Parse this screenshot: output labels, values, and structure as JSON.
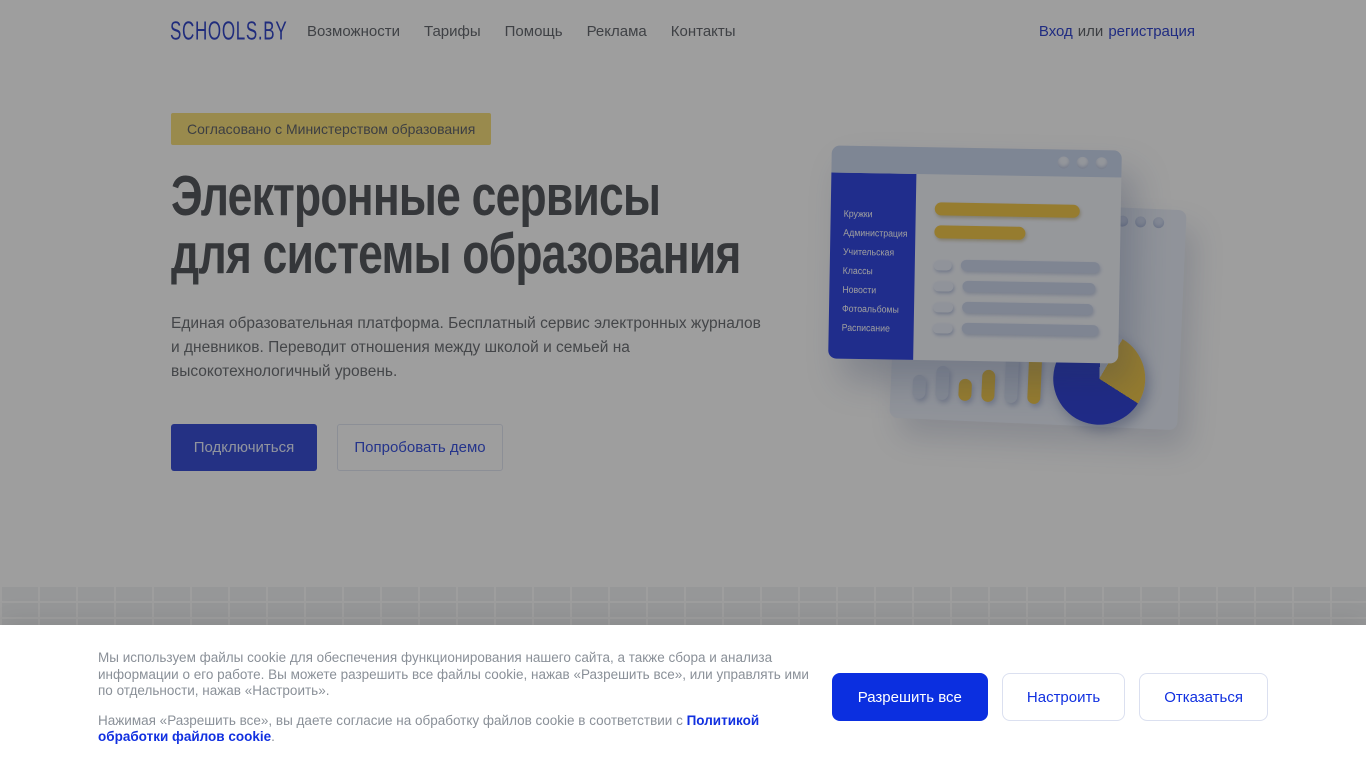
{
  "header": {
    "logo": "SCHOOLS.BY",
    "nav": [
      "Возможности",
      "Тарифы",
      "Помощь",
      "Реклама",
      "Контакты"
    ],
    "auth": {
      "login": "Вход",
      "separator": "или",
      "register": "регистрация"
    }
  },
  "hero": {
    "badge": "Согласовано с Министерством образования",
    "title_line1": "Электронные сервисы",
    "title_line2": "для системы образования",
    "description": "Единая образовательная платформа. Бесплатный сервис электронных журналов и дневников. Переводит отношения между школой и семьей на высокотехнологичный уровень.",
    "primary_button": "Подключиться",
    "secondary_button": "Попробовать демо"
  },
  "illustration": {
    "sidebar_items": [
      "Кружки",
      "Администрация",
      "Учительская",
      "Классы",
      "Новости",
      "Фотоальбомы",
      "Расписание"
    ]
  },
  "cookie_banner": {
    "paragraph1": "Мы используем файлы cookie для обеспечения функционирования нашего сайта, а также сбора и анализа информации о его работе. Вы можете разрешить все файлы cookie, нажав «Разрешить все», или управлять ими по отдельности, нажав «Настроить».",
    "paragraph2_prefix": "Нажимая «Разрешить все», вы даете согласие на обработку файлов cookie в соответствии с ",
    "paragraph2_link": "Политикой обработки файлов cookie",
    "paragraph2_suffix": ".",
    "allow_all_button": "Разрешить все",
    "configure_button": "Настроить",
    "decline_button": "Отказаться"
  },
  "colors": {
    "accent_blue": "#0b2fe0",
    "hero_button_blue": "#3a50d5",
    "badge_yellow": "#f7df7d",
    "sidebar_blue": "#3549e3",
    "chart_yellow": "#f2c94c",
    "overlay": "rgba(0,0,0,0.38)"
  }
}
